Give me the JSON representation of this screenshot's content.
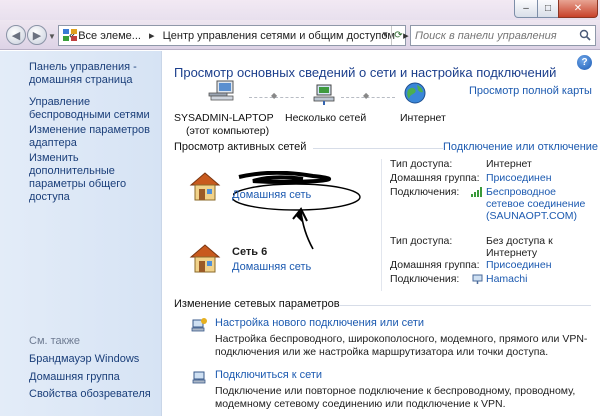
{
  "window": {
    "min": "–",
    "max": "□",
    "close": "✕"
  },
  "address": {
    "crumb_root": "Все элеме...",
    "crumb_current": "Центр управления сетями и общим доступом",
    "search_placeholder": "Поиск в панели управления"
  },
  "sidebar": {
    "items": [
      {
        "label": "Панель управления - домашняя страница"
      },
      {
        "label": "Управление беспроводными сетями"
      },
      {
        "label": "Изменение параметров адаптера"
      },
      {
        "label": "Изменить дополнительные параметры общего доступа"
      }
    ],
    "see_also_label": "См. также",
    "see_also": [
      {
        "label": "Брандмауэр Windows"
      },
      {
        "label": "Домашняя группа"
      },
      {
        "label": "Свойства обозревателя"
      }
    ]
  },
  "main": {
    "heading": "Просмотр основных сведений о сети и настройка подключений",
    "full_map": "Просмотр полной карты",
    "map": {
      "computer_name": "SYSADMIN-LAPTOP",
      "computer_sub": "(этот компьютер)",
      "networks": "Несколько сетей",
      "internet": "Интернет"
    },
    "active_title": "Просмотр активных сетей",
    "connect_toggle": "Подключение или отключение",
    "networks": [
      {
        "name": "",
        "type": "Домашняя сеть",
        "access_label": "Тип доступа:",
        "access": "Интернет",
        "group_label": "Домашняя группа:",
        "group": "Присоединен",
        "conn_label": "Подключения:",
        "conn": "Беспроводное сетевое соединение (SAUNAOPT.COM)"
      },
      {
        "name": "Сеть  6",
        "type": "Домашняя сеть",
        "access_label": "Тип доступа:",
        "access": "Без доступа к Интернету",
        "group_label": "Домашняя группа:",
        "group": "Присоединен",
        "conn_label": "Подключения:",
        "conn": "Hamachi"
      }
    ],
    "change_title": "Изменение сетевых параметров",
    "tasks": [
      {
        "title": "Настройка нового подключения или сети",
        "desc": "Настройка беспроводного, широкополосного, модемного, прямого или VPN-подключения или же настройка маршрутизатора или точки доступа."
      },
      {
        "title": "Подключиться к сети",
        "desc": "Подключение или повторное подключение к беспроводному, проводному, модемному сетевому соединению или подключение к VPN."
      }
    ]
  },
  "colors": {
    "link": "#1c5ab0",
    "heading": "#1c3f8c",
    "sidebar_bg": "#dce7f6"
  }
}
